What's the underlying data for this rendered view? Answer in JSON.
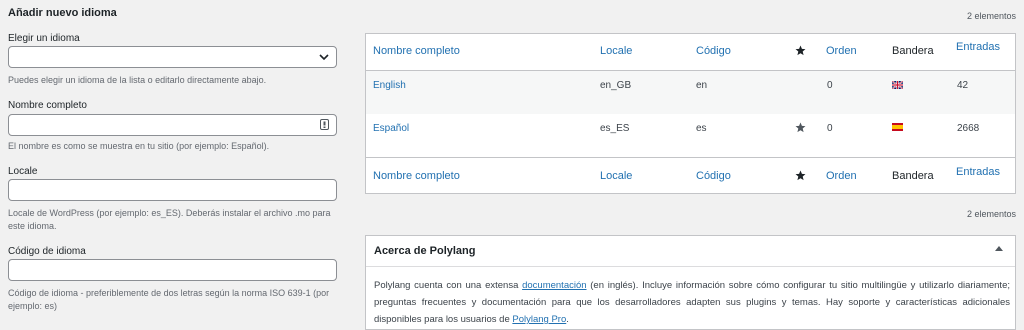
{
  "form": {
    "title": "Añadir nuevo idioma",
    "choose_label": "Elegir un idioma",
    "choose_value": "",
    "choose_desc": "Puedes elegir un idioma de la lista o editarlo directamente abajo.",
    "fullname_label": "Nombre completo",
    "fullname_value": "",
    "fullname_desc": "El nombre es como se muestra en tu sitio (por ejemplo: Español).",
    "locale_label": "Locale",
    "locale_value": "",
    "locale_desc": "Locale de WordPress (por ejemplo: es_ES). Deberás instalar el archivo .mo para este idioma.",
    "code_label": "Código de idioma",
    "code_value": "",
    "code_desc": "Código de idioma - preferiblemente de dos letras según la norma ISO 639-1 (por ejemplo: es)"
  },
  "table": {
    "count_top": "2 elementos",
    "count_bottom": "2 elementos",
    "headers": {
      "name": "Nombre completo",
      "locale": "Locale",
      "code": "Código",
      "order": "Orden",
      "flag": "Bandera",
      "posts": "Entradas"
    },
    "rows": [
      {
        "name": "English",
        "locale": "en_GB",
        "code": "en",
        "order": "0",
        "posts": "42",
        "default": false,
        "flag": "uk-flag-icon"
      },
      {
        "name": "Español",
        "locale": "es_ES",
        "code": "es",
        "order": "0",
        "posts": "2668",
        "default": true,
        "flag": "spain-flag-icon"
      }
    ]
  },
  "about": {
    "title": "Acerca de Polylang",
    "text_1": "Polylang cuenta con una extensa ",
    "link_doc": "documentación",
    "text_2": " (en inglés). Incluye información sobre cómo configurar tu sitio multilingüe y utilizarlo diariamente; preguntas frecuentes y documentación para que los desarrolladores adapten sus plugins y temas. Hay soporte y características adicionales disponibles para los usuarios de ",
    "link_pro": "Polylang Pro",
    "text_3": "."
  },
  "colors": {
    "link": "#2271b1",
    "background": "#f1f1f1"
  }
}
